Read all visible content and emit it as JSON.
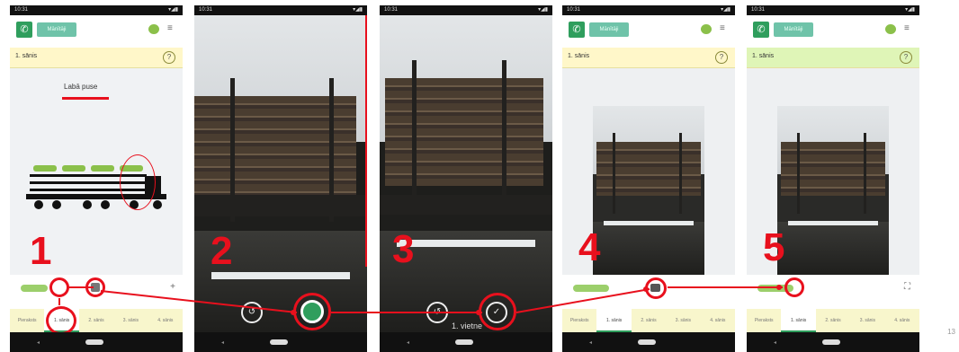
{
  "status": {
    "time": "10:31",
    "icons": "▾◢▮"
  },
  "appbar": {
    "call_icon": "phone-icon",
    "name_label": "Mānītāji",
    "menu_icon": "≡"
  },
  "section": {
    "label": "1. sānis",
    "help": "?"
  },
  "screen1": {
    "heading": "Labā puse",
    "truck_icon": "log-truck-icon"
  },
  "tabs": [
    "Pieraksts",
    "1. sānis",
    "2. sānis",
    "3. sānis",
    "4. sānis"
  ],
  "steps": [
    "1",
    "2",
    "3",
    "4",
    "5"
  ],
  "screen3": {
    "caption": "1. vietne"
  },
  "toolbar": {
    "plus": "+",
    "fullscreen": "⛶"
  },
  "page_number": "13",
  "colors": {
    "accent_red": "#e8101d",
    "green": "#2f9e5d",
    "yellow_bar": "#fff7c9"
  }
}
